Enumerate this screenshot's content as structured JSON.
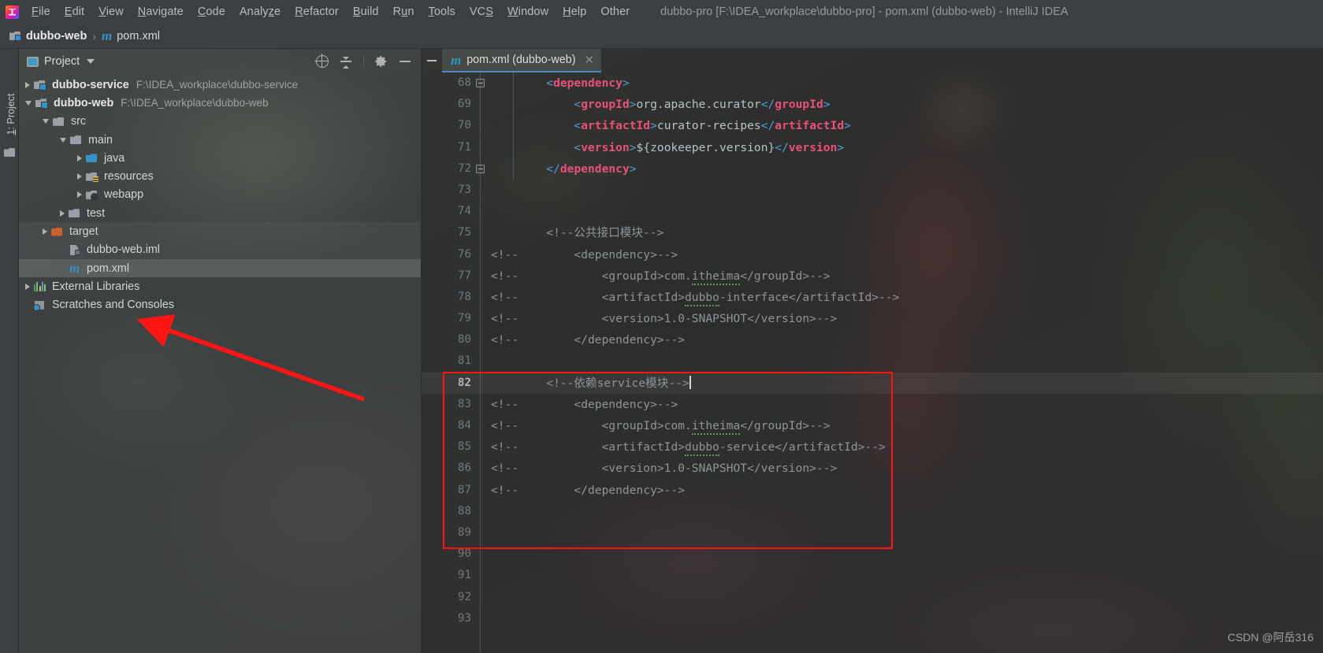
{
  "window": {
    "title": "dubbo-pro [F:\\IDEA_workplace\\dubbo-pro] - pom.xml (dubbo-web) - IntelliJ IDEA",
    "app_icon": "intellij-idea-logo"
  },
  "menubar": {
    "items": [
      {
        "label": "File",
        "mnemonic": "F"
      },
      {
        "label": "Edit",
        "mnemonic": "E"
      },
      {
        "label": "View",
        "mnemonic": "V"
      },
      {
        "label": "Navigate",
        "mnemonic": "N"
      },
      {
        "label": "Code",
        "mnemonic": "C"
      },
      {
        "label": "Analyze",
        "mnemonic": "z"
      },
      {
        "label": "Refactor",
        "mnemonic": "R"
      },
      {
        "label": "Build",
        "mnemonic": "B"
      },
      {
        "label": "Run",
        "mnemonic": "u"
      },
      {
        "label": "Tools",
        "mnemonic": "T"
      },
      {
        "label": "VCS",
        "mnemonic": "S"
      },
      {
        "label": "Window",
        "mnemonic": "W"
      },
      {
        "label": "Help",
        "mnemonic": "H"
      },
      {
        "label": "Other",
        "mnemonic": ""
      }
    ]
  },
  "breadcrumb": {
    "module": "dubbo-web",
    "separator": "›",
    "file": "pom.xml",
    "module_icon": "module-folder-icon",
    "file_icon": "maven-m-icon"
  },
  "toolstrip": {
    "project_tab": "1: Project",
    "project_tab_number": "1",
    "structure_icon": "folder-icon"
  },
  "project_panel": {
    "title": "Project",
    "title_icon": "project-view-icon",
    "dropdown_icon": "chevron-down-icon",
    "actions": [
      {
        "name": "locate-in-tree-icon",
        "tip": "Select Opened File"
      },
      {
        "name": "collapse-all-icon",
        "tip": "Collapse All"
      },
      {
        "name": "gear-icon",
        "tip": "Settings"
      },
      {
        "name": "hide-icon",
        "tip": "Hide"
      }
    ],
    "tree": [
      {
        "label": "dubbo-service",
        "path": "F:\\IDEA_workplace\\dubbo-service",
        "icon": "module-folder-icon",
        "indent": 0,
        "arrow": "right",
        "bold": true,
        "state": "normal"
      },
      {
        "label": "dubbo-web",
        "path": "F:\\IDEA_workplace\\dubbo-web",
        "icon": "module-folder-icon",
        "indent": 0,
        "arrow": "down",
        "bold": true,
        "state": "normal"
      },
      {
        "label": "src",
        "path": "",
        "icon": "folder-icon",
        "indent": 1,
        "arrow": "down",
        "bold": false,
        "state": "normal"
      },
      {
        "label": "main",
        "path": "",
        "icon": "folder-icon",
        "indent": 2,
        "arrow": "down",
        "bold": false,
        "state": "normal"
      },
      {
        "label": "java",
        "path": "",
        "icon": "source-folder-icon",
        "indent": 3,
        "arrow": "right",
        "bold": false,
        "state": "normal"
      },
      {
        "label": "resources",
        "path": "",
        "icon": "resources-folder-icon",
        "indent": 3,
        "arrow": "right",
        "bold": false,
        "state": "normal"
      },
      {
        "label": "webapp",
        "path": "",
        "icon": "web-folder-icon",
        "indent": 3,
        "arrow": "right",
        "bold": false,
        "state": "normal"
      },
      {
        "label": "test",
        "path": "",
        "icon": "folder-icon",
        "indent": 2,
        "arrow": "right",
        "bold": false,
        "state": "normal"
      },
      {
        "label": "target",
        "path": "",
        "icon": "excluded-folder-icon",
        "indent": 1,
        "arrow": "right",
        "bold": false,
        "state": "hover"
      },
      {
        "label": "dubbo-web.iml",
        "path": "",
        "icon": "iml-file-icon",
        "indent": 2,
        "arrow": "none",
        "bold": false,
        "state": "hover"
      },
      {
        "label": "pom.xml",
        "path": "",
        "icon": "maven-m-icon",
        "indent": 2,
        "arrow": "none",
        "bold": false,
        "state": "selected"
      },
      {
        "label": "External Libraries",
        "path": "",
        "icon": "libraries-icon",
        "indent": 0,
        "arrow": "right",
        "bold": false,
        "state": "normal"
      },
      {
        "label": "Scratches and Consoles",
        "path": "",
        "icon": "scratches-icon",
        "indent": 0,
        "arrow": "none",
        "bold": false,
        "state": "normal"
      }
    ]
  },
  "editor": {
    "minimize_icon": "minimize-icon",
    "tab": {
      "label": "pom.xml (dubbo-web)",
      "icon": "maven-m-icon",
      "close_icon": "close-icon",
      "active": true
    },
    "caret_line": 82,
    "lines": [
      {
        "n": "68",
        "indent": 0,
        "fold": "end",
        "tokens": [
          {
            "t": "brk",
            "v": "        <"
          },
          {
            "t": "tag",
            "v": "dependency"
          },
          {
            "t": "brk",
            "v": ">"
          }
        ],
        "clipped_top": true
      },
      {
        "n": "69",
        "indent": 0,
        "tokens": [
          {
            "t": "brk",
            "v": "            <"
          },
          {
            "t": "tag",
            "v": "groupId"
          },
          {
            "t": "brk",
            "v": ">"
          },
          {
            "t": "txt",
            "v": "org.apache.curator"
          },
          {
            "t": "brk",
            "v": "</"
          },
          {
            "t": "tag",
            "v": "groupId"
          },
          {
            "t": "brk",
            "v": ">"
          }
        ]
      },
      {
        "n": "70",
        "indent": 0,
        "tokens": [
          {
            "t": "brk",
            "v": "            <"
          },
          {
            "t": "tag",
            "v": "artifactId"
          },
          {
            "t": "brk",
            "v": ">"
          },
          {
            "t": "txt",
            "v": "curator-recipes"
          },
          {
            "t": "brk",
            "v": "</"
          },
          {
            "t": "tag",
            "v": "artifactId"
          },
          {
            "t": "brk",
            "v": ">"
          }
        ]
      },
      {
        "n": "71",
        "indent": 0,
        "tokens": [
          {
            "t": "brk",
            "v": "            <"
          },
          {
            "t": "tag",
            "v": "version"
          },
          {
            "t": "brk",
            "v": ">"
          },
          {
            "t": "txt",
            "v": "${zookeeper.version}"
          },
          {
            "t": "brk",
            "v": "</"
          },
          {
            "t": "tag",
            "v": "version"
          },
          {
            "t": "brk",
            "v": ">"
          }
        ]
      },
      {
        "n": "72",
        "indent": 0,
        "fold": "close",
        "tokens": [
          {
            "t": "brk",
            "v": "        </"
          },
          {
            "t": "tag",
            "v": "dependency"
          },
          {
            "t": "brk",
            "v": ">"
          }
        ]
      },
      {
        "n": "73",
        "indent": 0,
        "tokens": []
      },
      {
        "n": "74",
        "indent": 0,
        "tokens": []
      },
      {
        "n": "75",
        "indent": 0,
        "tokens": [
          {
            "t": "cmt",
            "v": "        <!--公共接口模块-->"
          }
        ]
      },
      {
        "n": "76",
        "indent": 0,
        "tokens": [
          {
            "t": "cmt",
            "v": "<!--        <dependency>-->"
          }
        ]
      },
      {
        "n": "77",
        "indent": 0,
        "tokens": [
          {
            "t": "cmt",
            "v": "<!--            <groupId>com."
          },
          {
            "t": "cmt-sq",
            "v": "itheima"
          },
          {
            "t": "cmt",
            "v": "</groupId>-->"
          }
        ]
      },
      {
        "n": "78",
        "indent": 0,
        "tokens": [
          {
            "t": "cmt",
            "v": "<!--            <artifactId>"
          },
          {
            "t": "cmt-sq",
            "v": "dubbo"
          },
          {
            "t": "cmt",
            "v": "-interface</artifactId>-->"
          }
        ]
      },
      {
        "n": "79",
        "indent": 0,
        "tokens": [
          {
            "t": "cmt",
            "v": "<!--            <version>1.0-SNAPSHOT</version>-->"
          }
        ]
      },
      {
        "n": "80",
        "indent": 0,
        "tokens": [
          {
            "t": "cmt",
            "v": "<!--        </dependency>-->"
          }
        ]
      },
      {
        "n": "81",
        "indent": 0,
        "tokens": []
      },
      {
        "n": "82",
        "indent": 0,
        "current": true,
        "caret": true,
        "tokens": [
          {
            "t": "cmt",
            "v": "        <!--依赖service模块-->"
          }
        ]
      },
      {
        "n": "83",
        "indent": 0,
        "tokens": [
          {
            "t": "cmt",
            "v": "<!--        <dependency>-->"
          }
        ]
      },
      {
        "n": "84",
        "indent": 0,
        "tokens": [
          {
            "t": "cmt",
            "v": "<!--            <groupId>com."
          },
          {
            "t": "cmt-sq",
            "v": "itheima"
          },
          {
            "t": "cmt",
            "v": "</groupId>-->"
          }
        ]
      },
      {
        "n": "85",
        "indent": 0,
        "tokens": [
          {
            "t": "cmt",
            "v": "<!--            <artifactId>"
          },
          {
            "t": "cmt-sq",
            "v": "dubbo"
          },
          {
            "t": "cmt",
            "v": "-service</artifactId>-->"
          }
        ]
      },
      {
        "n": "86",
        "indent": 0,
        "tokens": [
          {
            "t": "cmt",
            "v": "<!--            <version>1.0-SNAPSHOT</version>-->"
          }
        ]
      },
      {
        "n": "87",
        "indent": 0,
        "tokens": [
          {
            "t": "cmt",
            "v": "<!--        </dependency>-->"
          }
        ]
      },
      {
        "n": "88",
        "indent": 0,
        "tokens": []
      },
      {
        "n": "89",
        "indent": 0,
        "tokens": []
      },
      {
        "n": "90",
        "indent": 0,
        "tokens": []
      },
      {
        "n": "91",
        "indent": 0,
        "tokens": []
      },
      {
        "n": "92",
        "indent": 0,
        "tokens": []
      },
      {
        "n": "93",
        "indent": 0,
        "tokens": []
      }
    ]
  },
  "annotations": {
    "red_arrow": {
      "name": "red-arrow-pointer",
      "target": "pom.xml",
      "color": "#ff1414"
    },
    "red_box": {
      "name": "red-highlight-box",
      "color": "#ff1414",
      "covers_lines": "81-89"
    }
  },
  "watermark": {
    "text": "CSDN @阿岳316"
  },
  "colors": {
    "accent": "#3592c4",
    "tag": "#e8517c",
    "bracket": "#4a9fd4",
    "comment": "#8d9599",
    "annotation_red": "#ff1414",
    "panel_bg": "#3c3f41",
    "editor_bg": "#2b2b2b"
  }
}
